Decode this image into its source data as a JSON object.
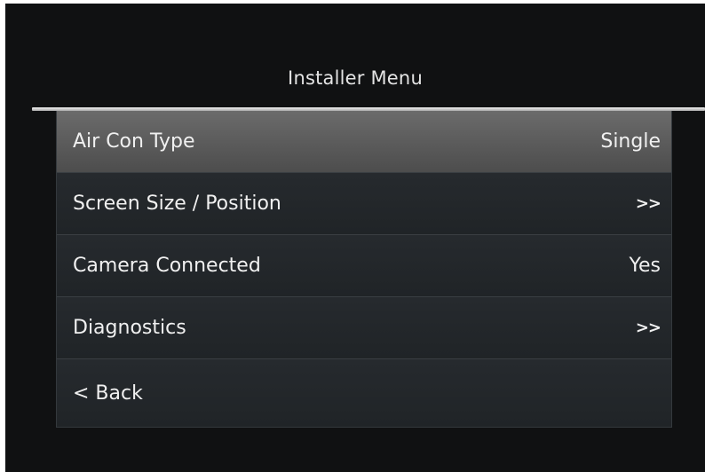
{
  "header": {
    "title": "Installer Menu"
  },
  "menu": {
    "items": [
      {
        "label": "Air Con Type",
        "value": "Single"
      },
      {
        "label": "Screen Size / Position",
        "value": ">>"
      },
      {
        "label": "Camera Connected",
        "value": "Yes"
      },
      {
        "label": "Diagnostics",
        "value": ">>"
      },
      {
        "label": "< Back",
        "value": ""
      }
    ]
  },
  "colors": {
    "background": "#101112",
    "row": "#212528",
    "selected_row": "#5a5a5a",
    "divider": "#d8d8d8",
    "text": "#f0f0f0"
  }
}
